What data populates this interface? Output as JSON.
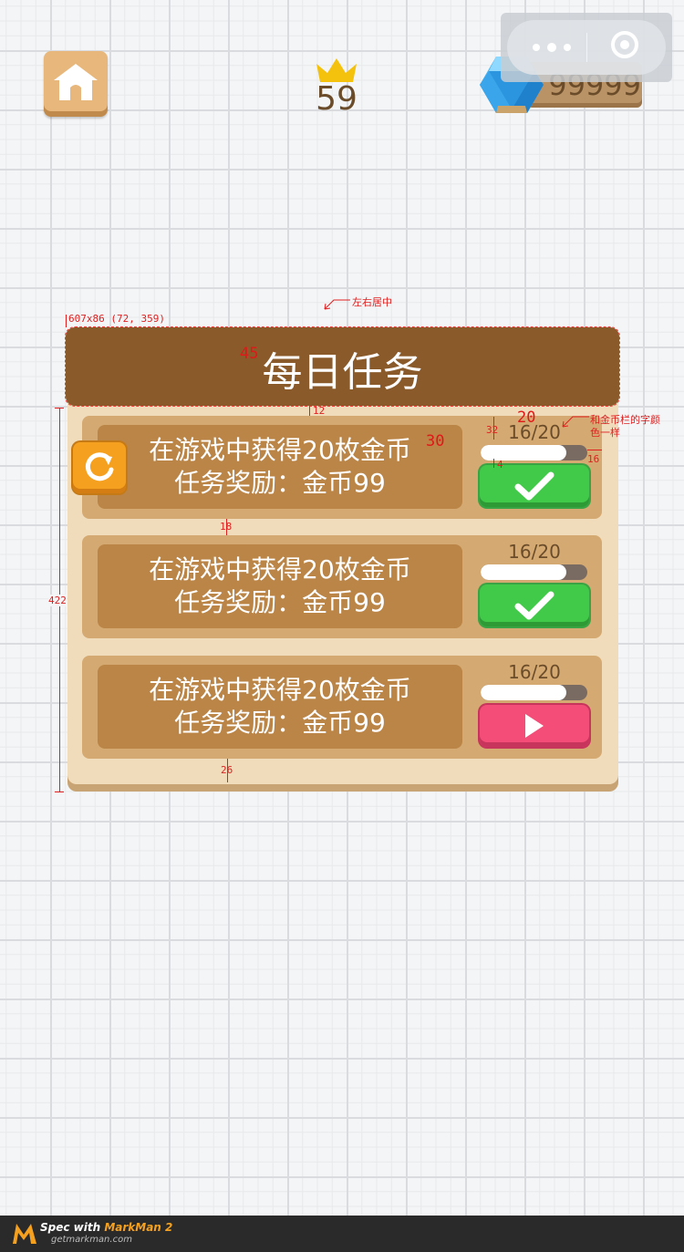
{
  "hud": {
    "level": "59",
    "gem_count": "99999",
    "icons": {
      "home": "home-icon",
      "crown": "crown-icon",
      "gem": "gem-icon",
      "more": "more-icon",
      "close": "close-circle-icon"
    }
  },
  "dialog": {
    "title": "每日任务",
    "tasks": [
      {
        "line1": "在游戏中获得20枚金币",
        "line2": "任务奖励：金币99",
        "progress_text": "16/20",
        "progress": 0.8,
        "action": "check-icon",
        "action_color": "#41c94a",
        "has_refresh": true
      },
      {
        "line1": "在游戏中获得20枚金币",
        "line2": "任务奖励：金币99",
        "progress_text": "16/20",
        "progress": 0.8,
        "action": "check-icon",
        "action_color": "#41c94a",
        "has_refresh": false
      },
      {
        "line1": "在游戏中获得20枚金币",
        "line2": "任务奖励：金币99",
        "progress_text": "16/20",
        "progress": 0.8,
        "action": "play-icon",
        "action_color": "#f34d78",
        "has_refresh": false
      }
    ]
  },
  "annotations": {
    "center_note": "左右居中",
    "box_info": "607x86 (72, 359)",
    "title_font": "45",
    "task_font": "30",
    "progress_font": "20",
    "color_note_1": "和金币栏的字颜",
    "color_note_2": "色一样",
    "gap_title": "12",
    "gap_cards": "18",
    "gap_bottom": "26",
    "height_total": "422",
    "h_progress_label": "32",
    "gap_bar_btn": "4",
    "right_margin": "16"
  },
  "footer": {
    "title_prefix": "Spec with ",
    "brand": "MarkMan 2",
    "url": "getmarkman.com"
  },
  "colors": {
    "title_bar": "#8a5a2b",
    "panel": "#f0dcbb",
    "card": "#d5aa72",
    "text_box": "#ba8547",
    "annotation": "#e02020"
  }
}
